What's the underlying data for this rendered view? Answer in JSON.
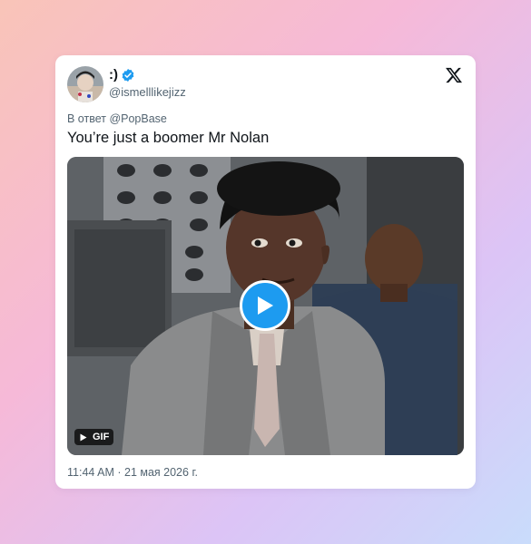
{
  "tweet": {
    "author": {
      "display_name": ":)",
      "handle": "@ismelllikejizz",
      "verified": true,
      "verified_color": "#1d9bf0"
    },
    "reply_to": "В ответ @PopBase",
    "text": "You’re just a boomer Mr Nolan",
    "media": {
      "type_label": "GIF",
      "play_button_color": "#1d9bf0"
    },
    "timestamp": "11:44 AM · 21 мая 2026 г."
  },
  "icons": {
    "brand": "x-logo-icon",
    "verified": "verified-badge-icon",
    "play": "play-icon",
    "gif_play": "small-play-icon"
  }
}
